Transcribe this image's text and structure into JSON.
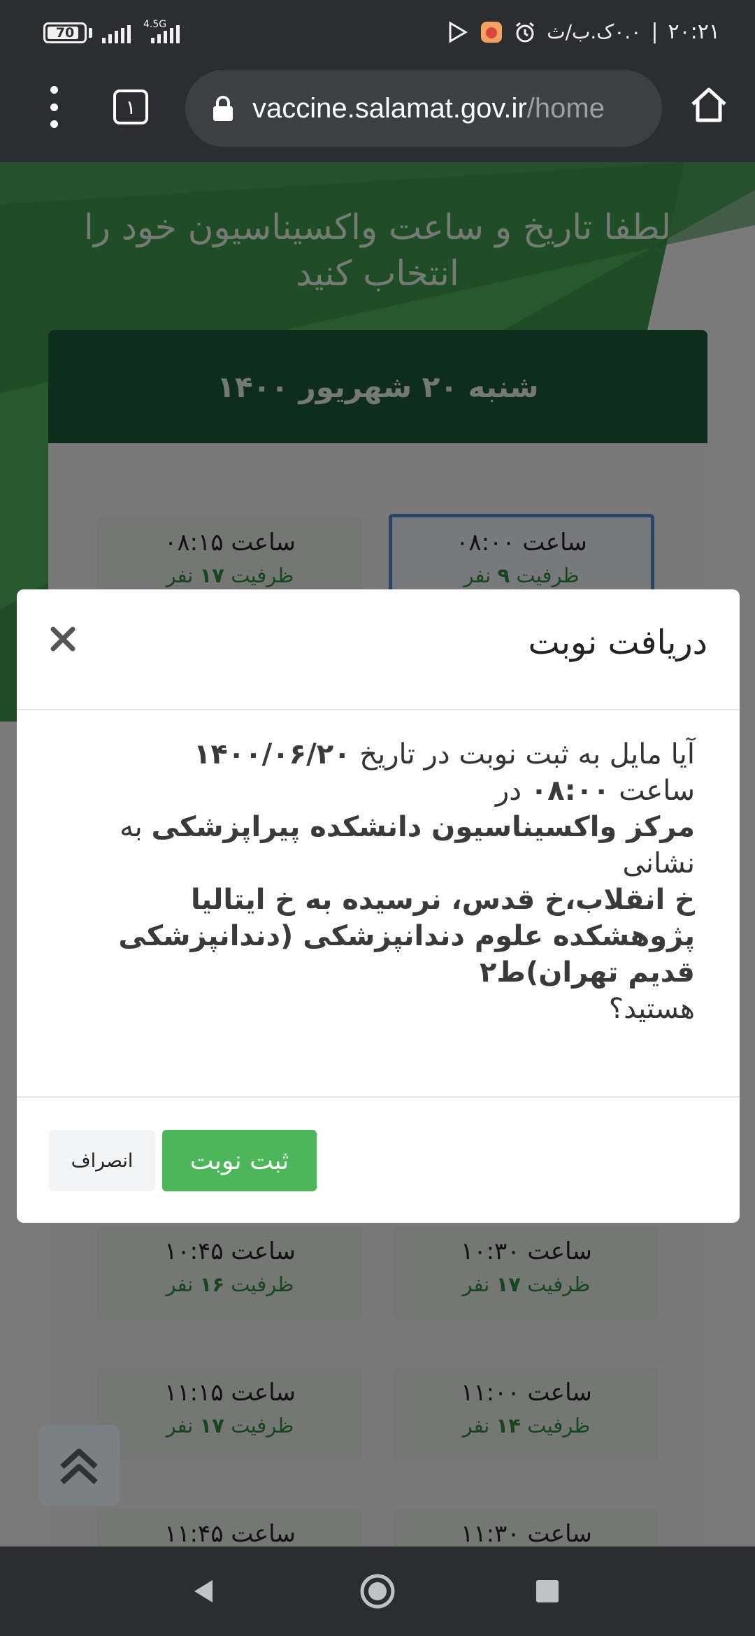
{
  "status_bar": {
    "time": "۲۰:۲۱",
    "separator": "|",
    "date": "۰.۰ک.ب/ث",
    "battery": "70",
    "network_type": "4.5G"
  },
  "browser": {
    "tab_count": "۱",
    "url_domain": "vaccine.salamat.gov.ir",
    "url_path": "/home"
  },
  "page": {
    "title": "لطفا تاریخ و ساعت واکسیناسیون خود را انتخاب کنید",
    "date_header": "شنبه ۲۰ شهریور ۱۴۰۰",
    "capacity_prefix": "ظرفیت",
    "capacity_suffix": "نفر",
    "slots": [
      {
        "time": "ساعت ۰۸:۰۰",
        "capacity": "۹"
      },
      {
        "time": "ساعت ۰۸:۱۵",
        "capacity": "۱۷"
      },
      {
        "time": "ساعت ۱۰:۳۰",
        "capacity": "۱۷"
      },
      {
        "time": "ساعت ۱۰:۴۵",
        "capacity": "۱۶"
      },
      {
        "time": "ساعت ۱۱:۰۰",
        "capacity": "۱۴"
      },
      {
        "time": "ساعت ۱۱:۱۵",
        "capacity": "۱۷"
      },
      {
        "time": "ساعت ۱۱:۳۰",
        "capacity": ""
      },
      {
        "time": "ساعت ۱۱:۴۵",
        "capacity": ""
      }
    ]
  },
  "modal": {
    "title": "دریافت نوبت",
    "text_1": "آیا مایل به ثبت نوبت در تاریخ",
    "date": "۱۴۰۰/۰۶/۲۰",
    "text_2": "ساعت",
    "time": "۰۸:۰۰",
    "text_3": "در",
    "center": "مرکز واکسیناسیون دانشکده پیراپزشکی",
    "text_4": "به نشانی",
    "address": "خ انقلاب،خ قدس، نرسیده به خ ایتالیا پژوهشکده علوم دندانپزشکی (دندانپزشکی قدیم تهران)ط۲",
    "text_5": "هستید؟",
    "confirm_label": "ثبت نوبت",
    "cancel_label": "انصراف"
  },
  "colors": {
    "header_green": "#1e5a38",
    "confirm_green": "#4cb75a",
    "selected_border": "#4f89c9",
    "capacity_green": "#2e8b3a"
  }
}
